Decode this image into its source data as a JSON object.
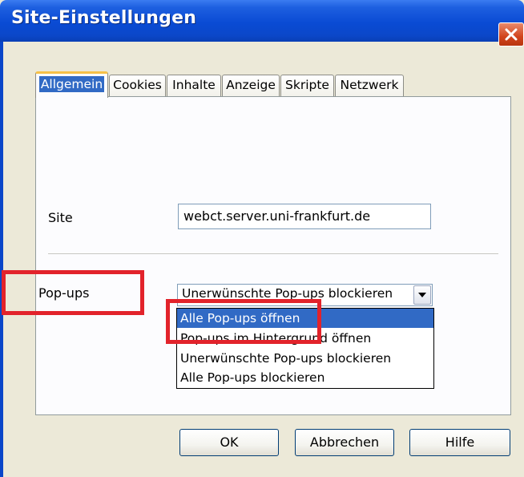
{
  "window": {
    "title": "Site-Einstellungen"
  },
  "tabs": [
    "Allgemein",
    "Cookies",
    "Inhalte",
    "Anzeige",
    "Skripte",
    "Netzwerk"
  ],
  "form": {
    "site_label": "Site",
    "site_value": "webct.server.uni-frankfurt.de",
    "popups_label": "Pop-ups",
    "popups_selected": "Unerwünschte Pop-ups blockieren",
    "popups_options": [
      "Alle Pop-ups öffnen",
      "Pop-ups im Hintergrund öffnen",
      "Unerwünschte Pop-ups blockieren",
      "Alle Pop-ups blockieren"
    ],
    "highlighted_option_index": 0
  },
  "buttons": {
    "ok": "OK",
    "cancel": "Abbrechen",
    "help": "Hilfe"
  },
  "colors": {
    "highlight": "#316ac5",
    "annotation": "#e2232b",
    "titlebar": "#0a4bd4"
  },
  "icons": {
    "close": "close-icon",
    "dropdown": "chevron-down-icon"
  }
}
